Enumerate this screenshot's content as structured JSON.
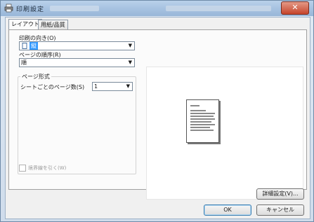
{
  "window": {
    "title": "印刷設定",
    "close_label": "✕"
  },
  "tabs": [
    {
      "label": "レイアウト"
    },
    {
      "label": "用紙/品質"
    }
  ],
  "layout": {
    "orientation_label": "印刷の向き(O)",
    "orientation_value": "縦",
    "page_order_label": "ページの順序(R)",
    "page_order_value": "順",
    "page_format_label": "ページ形式",
    "pages_per_sheet_label": "シートごとのページ数(S)",
    "pages_per_sheet_value": "1",
    "booklet_label": "境界線を引く(W)"
  },
  "buttons": {
    "advanced_label": "詳細設定(V)...",
    "ok_label": "OK",
    "cancel_label": "キャンセル"
  }
}
